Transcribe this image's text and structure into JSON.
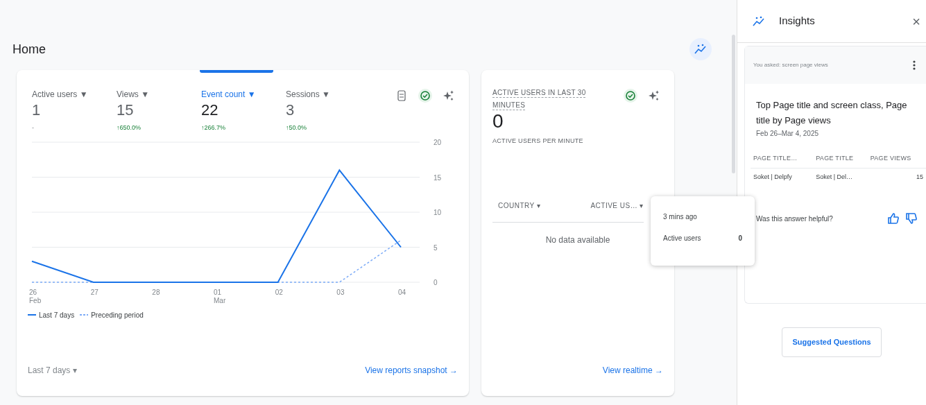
{
  "page": {
    "title": "Home"
  },
  "overview_card": {
    "metrics": [
      {
        "label": "Active users",
        "caret": "▼",
        "value": "1",
        "change": "-",
        "increase": false,
        "selected": false
      },
      {
        "label": "Views",
        "caret": "▼",
        "value": "15",
        "change": "↑650.0%",
        "increase": true,
        "selected": false
      },
      {
        "label": "Event count",
        "caret": "▼",
        "value": "22",
        "change": "↑266.7%",
        "increase": true,
        "selected": true
      },
      {
        "label": "Sessions",
        "caret": "▼",
        "value": "3",
        "change": "↑50.0%",
        "increase": true,
        "selected": false
      }
    ],
    "chart_data": {
      "type": "line",
      "grid": true,
      "categories": [
        "26 Feb",
        "27",
        "28",
        "01 Mar",
        "02",
        "03",
        "04"
      ],
      "ylim": [
        0,
        20
      ],
      "yticks": [
        0,
        5,
        10,
        15,
        20
      ],
      "series": [
        {
          "name": "Last 7 days",
          "color": "#1a73e8",
          "line_style": "solid",
          "values": [
            3,
            0,
            0,
            0,
            0,
            16,
            5
          ]
        },
        {
          "name": "Preceding period",
          "color": "#7baaf7",
          "line_style": "dashed",
          "values": [
            0,
            0,
            0,
            0,
            0,
            0,
            6
          ]
        }
      ]
    },
    "date_range": {
      "label": "Last 7 days",
      "caret": "▾"
    },
    "link": {
      "label": "View reports snapshot",
      "arrow": "→"
    }
  },
  "realtime_card": {
    "title": "ACTIVE USERS IN LAST 30 MINUTES",
    "value": "0",
    "subtitle": "ACTIVE USERS PER MINUTE",
    "columns": [
      {
        "label": "COUNTRY",
        "caret": "▾"
      },
      {
        "label": "ACTIVE US…",
        "caret": "▾"
      }
    ],
    "empty_text": "No data available",
    "link": {
      "label": "View realtime",
      "arrow": "→"
    }
  },
  "tooltip": {
    "time": "3 mins ago",
    "label": "Active users",
    "value": "0"
  },
  "insights_panel": {
    "title": "Insights",
    "close": "×",
    "question": "You asked: screen page views",
    "heading": "Top Page title and screen class, Page title by Page views",
    "date": "Feb 26–Mar 4, 2025",
    "columns": [
      "PAGE TITLE…",
      "PAGE TITLE",
      "PAGE VIEWS"
    ],
    "rows": [
      [
        "Soket | Delpfy",
        "Soket | Del…",
        "15"
      ]
    ],
    "feedback": "Was this answer helpful?",
    "button": "Suggested Questions"
  }
}
